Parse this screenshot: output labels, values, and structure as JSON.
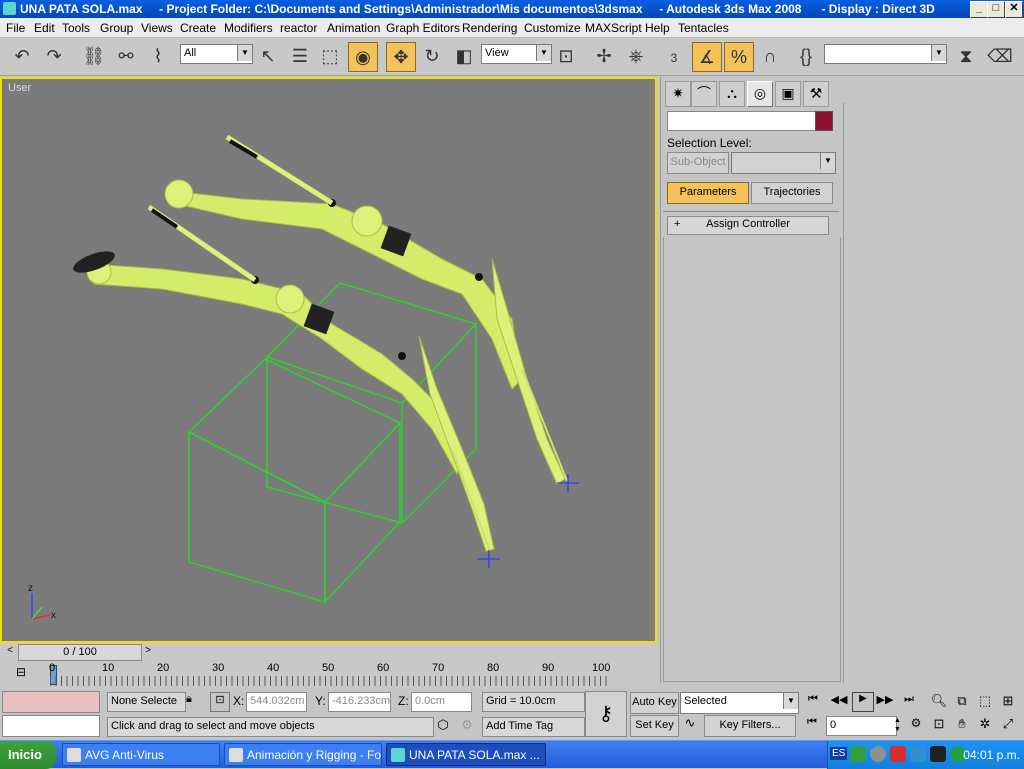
{
  "window": {
    "title": "UNA PATA SOLA.max     - Project Folder: C:\\Documents and Settings\\Administrador\\Mis documentos\\3dsmax     - Autodesk 3ds Max 2008      - Display : Direct 3D",
    "min": "_",
    "max": "□",
    "close": "✕"
  },
  "menu": [
    "File",
    "Edit",
    "Tools",
    "Group",
    "Views",
    "Create",
    "Modifiers",
    "reactor",
    "Animation",
    "Graph Editors",
    "Rendering",
    "Customize",
    "MAXScript",
    "Help",
    "Tentacles"
  ],
  "toolbar": {
    "selection_filter": "All",
    "ref_coord": "View",
    "named_selection": "",
    "snap_angle_label": "3",
    "percent_label": "%"
  },
  "viewport": {
    "label": "User",
    "axis_z": "z",
    "axis_x": "x"
  },
  "command_panel": {
    "selection_level_label": "Selection Level:",
    "subobject_label": "Sub-Object",
    "parameters_tab": "Parameters",
    "trajectories_tab": "Trajectories",
    "rollout_plus": "+",
    "assign_controller": "Assign Controller",
    "color_swatch": "#8a1030"
  },
  "timeline": {
    "frame_display": "0 / 100",
    "ticks": [
      "0",
      "10",
      "20",
      "30",
      "40",
      "50",
      "60",
      "70",
      "80",
      "90",
      "100"
    ]
  },
  "status": {
    "selection": "None Selecte",
    "x_label": "X:",
    "x_value": "544.032cm",
    "y_label": "Y:",
    "y_value": "-416.233cm",
    "z_label": "Z:",
    "z_value": "0.0cm",
    "grid": "Grid = 10.0cm",
    "prompt": "Click and drag to select and move objects",
    "add_time_tag": "Add Time Tag",
    "auto_key": "Auto Key",
    "set_key": "Set Key",
    "key_mode": "Selected",
    "key_filters": "Key Filters...",
    "current_frame": "0"
  },
  "taskbar": {
    "start": "Inicio",
    "tasks": [
      "AVG Anti-Virus",
      "Animación y Rigging - Fo...",
      "UNA PATA SOLA.max ..."
    ],
    "language": "ES",
    "clock": "04:01 p.m."
  }
}
